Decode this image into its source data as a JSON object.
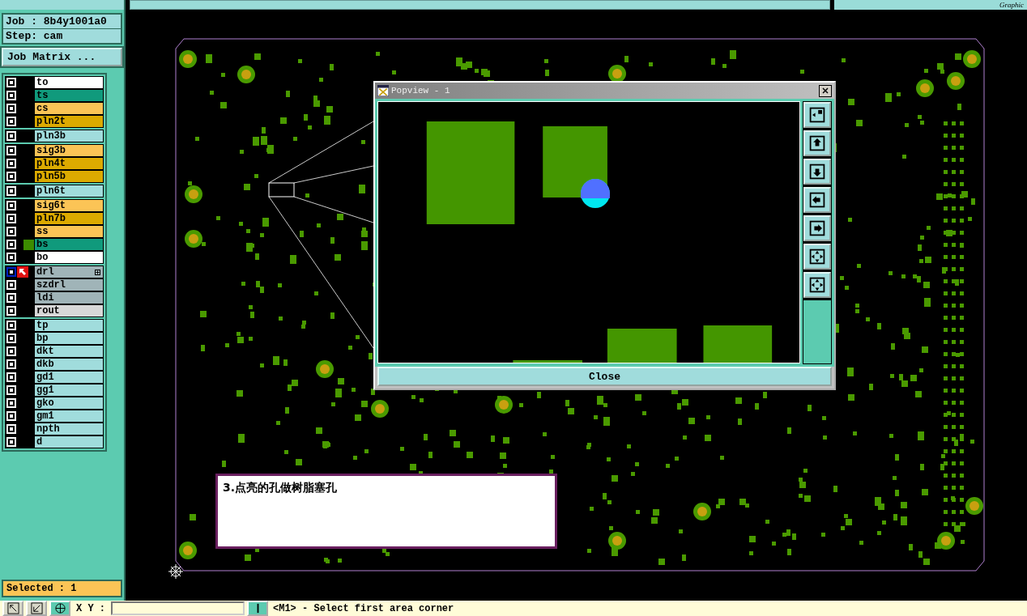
{
  "job": {
    "job_label": "Job : 8b4y1001a0",
    "step_label": "Step: cam",
    "matrix_button": "Job Matrix ..."
  },
  "layer_groups": [
    {
      "layers": [
        {
          "name": "to",
          "color": "#ffffff",
          "checked": true,
          "selected": false,
          "displayed": false
        },
        {
          "name": "ts",
          "color": "#109a7c",
          "checked": true,
          "selected": false,
          "displayed": false
        },
        {
          "name": "cs",
          "color": "#fbc456",
          "checked": true,
          "selected": false,
          "displayed": false
        },
        {
          "name": "pln2t",
          "color": "#dcaa00",
          "checked": true,
          "selected": false,
          "displayed": false
        }
      ]
    },
    {
      "layers": [
        {
          "name": "pln3b",
          "color": "#a0dcdc",
          "checked": true,
          "selected": false,
          "displayed": false
        }
      ]
    },
    {
      "layers": [
        {
          "name": "sig3b",
          "color": "#fbc456",
          "checked": true,
          "selected": false,
          "displayed": false
        },
        {
          "name": "pln4t",
          "color": "#dcaa00",
          "checked": true,
          "selected": false,
          "displayed": false
        },
        {
          "name": "pln5b",
          "color": "#dcaa00",
          "checked": true,
          "selected": false,
          "displayed": false
        }
      ]
    },
    {
      "layers": [
        {
          "name": "pln6t",
          "color": "#a0dcdc",
          "checked": true,
          "selected": false,
          "displayed": false
        }
      ]
    },
    {
      "layers": [
        {
          "name": "sig6t",
          "color": "#fbc456",
          "checked": true,
          "selected": false,
          "displayed": false
        },
        {
          "name": "pln7b",
          "color": "#dcaa00",
          "checked": true,
          "selected": false,
          "displayed": false
        },
        {
          "name": "ss",
          "color": "#fbc456",
          "checked": true,
          "selected": false,
          "displayed": false
        },
        {
          "name": "bs",
          "color": "#109a7c",
          "checked": true,
          "selected": false,
          "displayed": true
        },
        {
          "name": "bo",
          "color": "#ffffff",
          "checked": true,
          "selected": false,
          "displayed": false
        }
      ]
    },
    {
      "layers": [
        {
          "name": "drl",
          "color": "#a0b4b8",
          "checked": true,
          "selected": true,
          "displayed": false
        },
        {
          "name": "szdrl",
          "color": "#a0b4b8",
          "checked": true,
          "selected": false,
          "displayed": false
        },
        {
          "name": "ldi",
          "color": "#a0b4b8",
          "checked": true,
          "selected": false,
          "displayed": false
        },
        {
          "name": "rout",
          "color": "#d8d8d8",
          "checked": true,
          "selected": false,
          "displayed": false
        }
      ]
    },
    {
      "layers": [
        {
          "name": "tp",
          "color": "#a0dcdc",
          "checked": true,
          "selected": false,
          "displayed": false
        },
        {
          "name": "bp",
          "color": "#a0dcdc",
          "checked": true,
          "selected": false,
          "displayed": false
        },
        {
          "name": "dkt",
          "color": "#a0dcdc",
          "checked": true,
          "selected": false,
          "displayed": false
        },
        {
          "name": "dkb",
          "color": "#a0dcdc",
          "checked": true,
          "selected": false,
          "displayed": false
        },
        {
          "name": "gd1",
          "color": "#a0dcdc",
          "checked": true,
          "selected": false,
          "displayed": false
        },
        {
          "name": "gg1",
          "color": "#a0dcdc",
          "checked": true,
          "selected": false,
          "displayed": false
        },
        {
          "name": "gko",
          "color": "#a0dcdc",
          "checked": true,
          "selected": false,
          "displayed": false
        },
        {
          "name": "gm1",
          "color": "#a0dcdc",
          "checked": true,
          "selected": false,
          "displayed": false
        },
        {
          "name": "npth",
          "color": "#a0dcdc",
          "checked": true,
          "selected": false,
          "displayed": false
        },
        {
          "name": "d",
          "color": "#a0dcdc",
          "checked": true,
          "selected": false,
          "displayed": false
        }
      ]
    }
  ],
  "selected_count": "Selected : 1",
  "top_bar": {
    "label": "Graphic"
  },
  "popview": {
    "title": "Popview - 1",
    "close_button": "Close"
  },
  "note": {
    "text": "3.点亮的孔做树脂塞孔"
  },
  "bottom_bar": {
    "xy_label": "X Y :",
    "prompt": "<M1> - Select first area corner"
  }
}
